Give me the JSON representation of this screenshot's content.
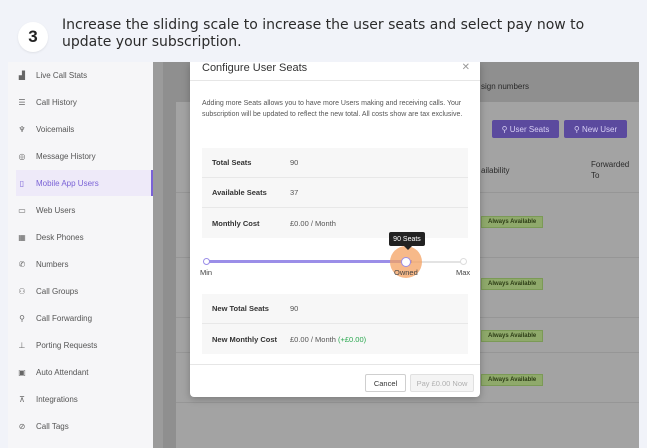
{
  "step": {
    "number": "3",
    "instruction": "Increase the sliding scale to increase the user seats and select pay now to update your subscription."
  },
  "sidebar": {
    "items": [
      {
        "label": "Live Call Stats",
        "icon": "bar-chart-icon"
      },
      {
        "label": "Call History",
        "icon": "list-icon"
      },
      {
        "label": "Voicemails",
        "icon": "voicemail-icon"
      },
      {
        "label": "Message History",
        "icon": "message-icon"
      },
      {
        "label": "Mobile App Users",
        "icon": "mobile-icon"
      },
      {
        "label": "Web Users",
        "icon": "monitor-icon"
      },
      {
        "label": "Desk Phones",
        "icon": "desk-phone-icon"
      },
      {
        "label": "Numbers",
        "icon": "phone-icon"
      },
      {
        "label": "Call Groups",
        "icon": "users-icon"
      },
      {
        "label": "Call Forwarding",
        "icon": "user-forward-icon"
      },
      {
        "label": "Porting Requests",
        "icon": "porting-icon"
      },
      {
        "label": "Auto Attendant",
        "icon": "attendant-icon"
      },
      {
        "label": "Integrations",
        "icon": "integrations-icon"
      },
      {
        "label": "Call Tags",
        "icon": "tag-icon"
      }
    ],
    "active_index": 4
  },
  "background": {
    "assign_numbers_text": "sign numbers",
    "user_seats_button": "User Seats",
    "new_user_button": "New User",
    "col_availability": "ailability",
    "col_forwarded_to": "Forwarded To",
    "badge_label": "Always Available"
  },
  "modal": {
    "title": "Configure User Seats",
    "description": "Adding more Seats allows you to have more Users making and receiving calls. Your subscription will be updated to reflect the new total. All costs show are tax exclusive.",
    "current": {
      "total_seats_label": "Total Seats",
      "total_seats_value": "90",
      "available_seats_label": "Available Seats",
      "available_seats_value": "37",
      "monthly_cost_label": "Monthly Cost",
      "monthly_cost_value": "£0.00 / Month"
    },
    "slider": {
      "tooltip": "90 Seats",
      "min_label": "Min",
      "owned_label": "Owned",
      "max_label": "Max",
      "value_fraction": 0.8
    },
    "new": {
      "total_seats_label": "New Total Seats",
      "total_seats_value": "90",
      "monthly_cost_label": "New Monthly Cost",
      "monthly_cost_value": "£0.00 / Month",
      "monthly_cost_delta": "(+£0.00)"
    },
    "cancel_button": "Cancel",
    "pay_button": "Pay £0.00 Now"
  },
  "colors": {
    "accent": "#7a62d6",
    "slider": "#9b8ee8",
    "highlight": "#f4a261",
    "positive": "#2aa84f"
  }
}
